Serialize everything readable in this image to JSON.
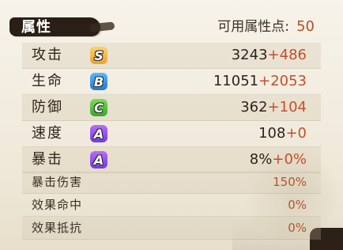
{
  "header": {
    "title": "属性",
    "available_points_label": "可用属性点:",
    "available_points_value": "50"
  },
  "stats": [
    {
      "label": "攻击",
      "grade": "S",
      "base": "3243",
      "bonus": "+486"
    },
    {
      "label": "生命",
      "grade": "B",
      "base": "11051",
      "bonus": "+2053"
    },
    {
      "label": "防御",
      "grade": "C",
      "base": "362",
      "bonus": "+104"
    },
    {
      "label": "速度",
      "grade": "A",
      "base": "108",
      "bonus": "+0"
    },
    {
      "label": "暴击",
      "grade": "A",
      "base": "8%",
      "bonus": "+0%"
    }
  ],
  "secondary": [
    {
      "label": "暴击伤害",
      "value": "150%"
    },
    {
      "label": "效果命中",
      "value": "0%"
    },
    {
      "label": "效果抵抗",
      "value": "0%"
    }
  ],
  "colors": {
    "bonus": "#c24f2c",
    "grade_S": "#f0a12b",
    "grade_B": "#1f79d0",
    "grade_C": "#36a82a",
    "grade_A": "#6f3be2"
  }
}
